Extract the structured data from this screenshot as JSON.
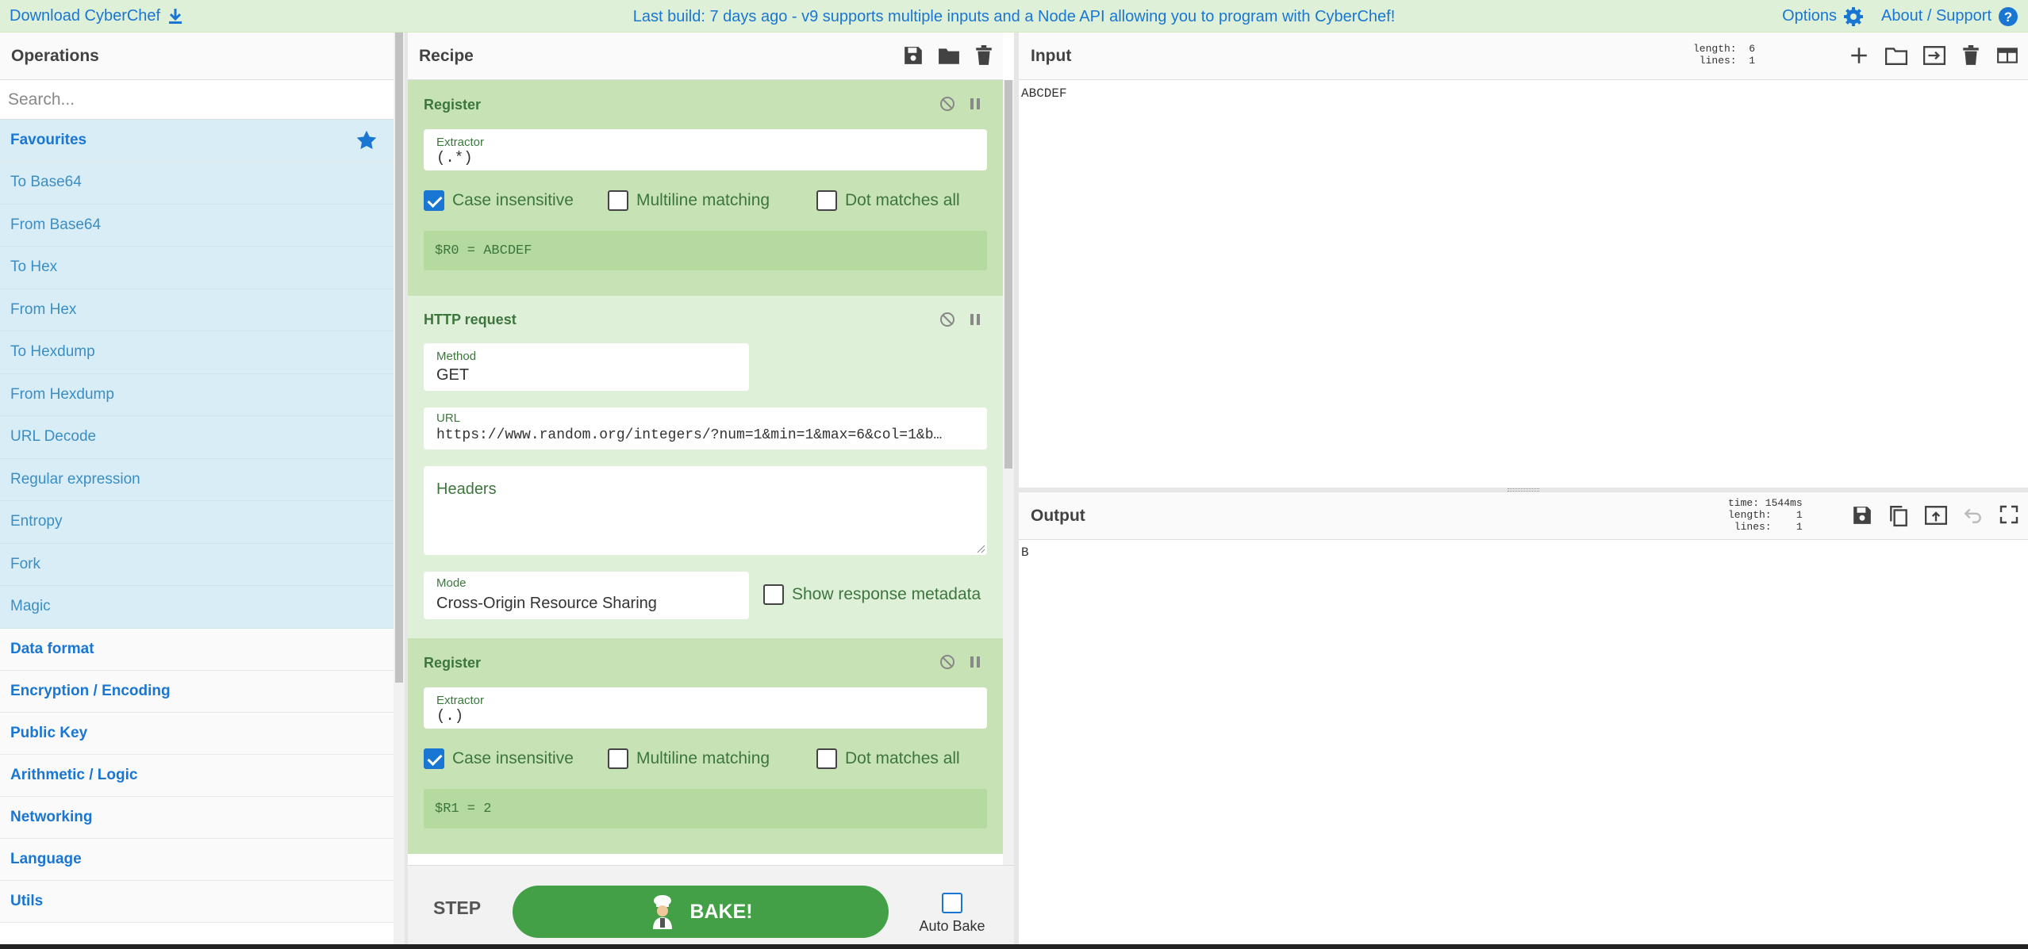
{
  "banner": {
    "download": "Download CyberChef",
    "message": "Last build: 7 days ago - v9 supports multiple inputs and a Node API allowing you to program with CyberChef!",
    "options": "Options",
    "about": "About / Support"
  },
  "operations": {
    "title": "Operations",
    "search_placeholder": "Search...",
    "favourites": "Favourites",
    "favourite_items": [
      "To Base64",
      "From Base64",
      "To Hex",
      "From Hex",
      "To Hexdump",
      "From Hexdump",
      "URL Decode",
      "Regular expression",
      "Entropy",
      "Fork",
      "Magic"
    ],
    "categories": [
      "Data format",
      "Encryption / Encoding",
      "Public Key",
      "Arithmetic / Logic",
      "Networking",
      "Language",
      "Utils"
    ]
  },
  "recipe": {
    "title": "Recipe",
    "ops": [
      {
        "name": "Register",
        "extractor_label": "Extractor",
        "extractor": "(.*)",
        "case_insensitive": "Case insensitive",
        "multiline": "Multiline matching",
        "dotall": "Dot matches all",
        "output": "$R0 = ABCDEF"
      },
      {
        "name": "HTTP request",
        "method_label": "Method",
        "method": "GET",
        "url_label": "URL",
        "url": "https://www.random.org/integers/?num=1&min=1&max=6&col=1&b…",
        "headers_placeholder": "Headers",
        "mode_label": "Mode",
        "mode": "Cross-Origin Resource Sharing",
        "show_metadata": "Show response metadata"
      },
      {
        "name": "Register",
        "extractor_label": "Extractor",
        "extractor": "(.)",
        "case_insensitive": "Case insensitive",
        "multiline": "Multiline matching",
        "dotall": "Dot matches all",
        "output": "$R1 = 2"
      }
    ]
  },
  "controls": {
    "step": "STEP",
    "bake": "BAKE!",
    "auto_bake": "Auto Bake"
  },
  "input": {
    "title": "Input",
    "stats": "length:  6\n lines:  1",
    "text": "ABCDEF"
  },
  "output": {
    "title": "Output",
    "stats": "time: 1544ms\nlength:    1\n lines:    1",
    "text": "B"
  },
  "colors": {
    "accent": "#1976d2",
    "bake": "#43a047",
    "register_bg": "#c7e3b6",
    "http_bg": "#dff0d8",
    "favourites_bg": "#d9edf7"
  }
}
